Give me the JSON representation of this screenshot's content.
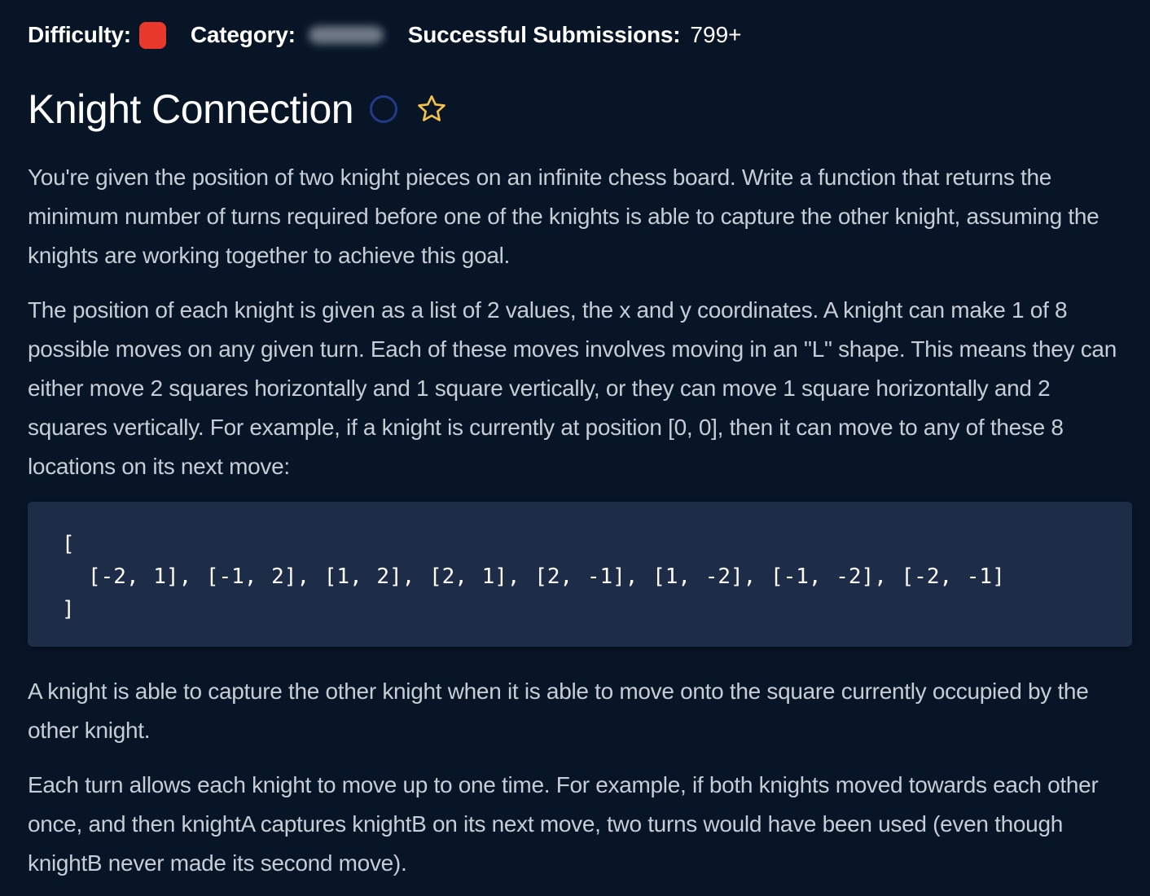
{
  "meta": {
    "difficulty_label": "Difficulty:",
    "difficulty_color": "#e8392c",
    "category_label": "Category:",
    "submissions_label": "Successful Submissions:",
    "submissions_value": "799+"
  },
  "problem": {
    "title": "Knight Connection",
    "status_icon": "circle-outline-icon",
    "favorite_icon": "star-outline-icon",
    "accent_colors": {
      "star": "#f2c14e",
      "status_circle": "#23398a"
    }
  },
  "description": {
    "paragraph_1": "You're given the position of two knight pieces on an infinite chess board. Write a function that returns the minimum number of turns required before one of the knights is able to capture the other knight, assuming the knights are working together to achieve this goal.",
    "paragraph_2": "The position of each knight is given as a list of 2 values, the x and y coordinates. A knight can make 1 of 8 possible moves on any given turn. Each of these moves involves moving in an \"L\" shape. This means they can either move 2 squares horizontally and 1 square vertically, or they can move 1 square horizontally and 2 squares vertically. For example, if a knight is currently at position [0, 0], then it can move to any of these 8 locations on its next move:",
    "code_open": "[",
    "code_body": "[-2, 1], [-1, 2], [1, 2], [2, 1], [2, -1], [1, -2], [-1, -2], [-2, -1]",
    "code_close": "]",
    "paragraph_3": "A knight is able to capture the other knight when it is able to move onto the square currently occupied by the other knight.",
    "paragraph_4": "Each turn allows each knight to move up to one time. For example, if both knights moved towards each other once, and then knightA captures knightB on its next move, two turns would have been used (even though knightB never made its second move)."
  }
}
